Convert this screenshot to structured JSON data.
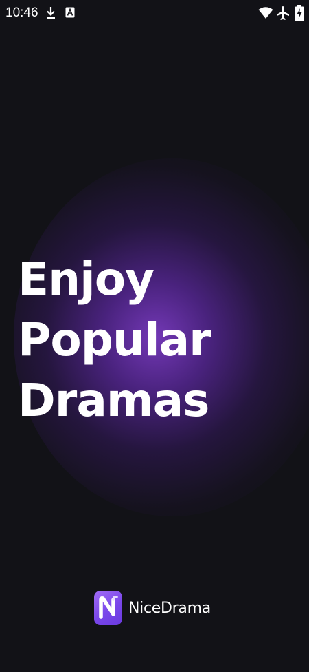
{
  "status_bar": {
    "time": "10:46",
    "icons": [
      "download-icon",
      "a-notification-icon",
      "wifi-icon",
      "airplane-mode-icon",
      "battery-charging-icon"
    ]
  },
  "splash": {
    "headline_lines": [
      "Enjoy",
      "Popular",
      "Dramas"
    ]
  },
  "brand": {
    "name": "NiceDrama",
    "logo_icon": "nicedrama-logo-icon",
    "logo_color": "#8a57f0"
  },
  "colors": {
    "background": "#121217",
    "glow": "#7a3ac0",
    "text": "#ffffff"
  }
}
